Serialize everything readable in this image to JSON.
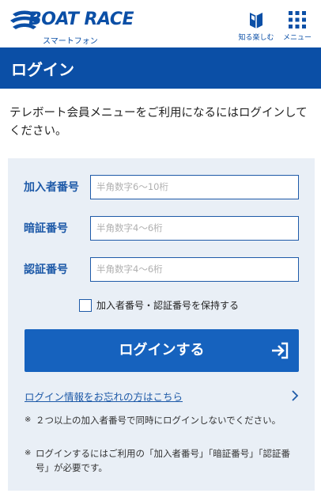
{
  "header": {
    "logo_text": "BOAT RACE",
    "logo_sub": "スマートフォン",
    "nav_learn_label": "知る楽しむ",
    "nav_menu_label": "メニュー"
  },
  "page": {
    "title": "ログイン",
    "intro": "テレボート会員メニューをご利用になるにはログインしてください。"
  },
  "form": {
    "member_label": "加入者番号",
    "member_placeholder": "半角数字6～10桁",
    "pin_label": "暗証番号",
    "pin_placeholder": "半角数字4～6桁",
    "auth_label": "認証番号",
    "auth_placeholder": "半角数字4～6桁",
    "keep_label": "加入者番号・認証番号を保持する",
    "keep_checked": false,
    "login_button": "ログインする",
    "forgot_link": "ログイン情報をお忘れの方はこちら"
  },
  "notes": {
    "mark": "※",
    "note1": "２つ以上の加入者番号で同時にログインしないでください。",
    "note2": "ログインするにはご利用の「加入者番号」「暗証番号」「認証番号」が必要です。"
  },
  "colors": {
    "brand_blue": "#0b4fa6",
    "button_blue": "#1662be",
    "panel_bg": "#e9eff6"
  },
  "icons": {
    "learn": "book-icon",
    "menu": "grid-icon",
    "login": "login-arrow-icon",
    "forgot": "chevron-right-icon"
  }
}
